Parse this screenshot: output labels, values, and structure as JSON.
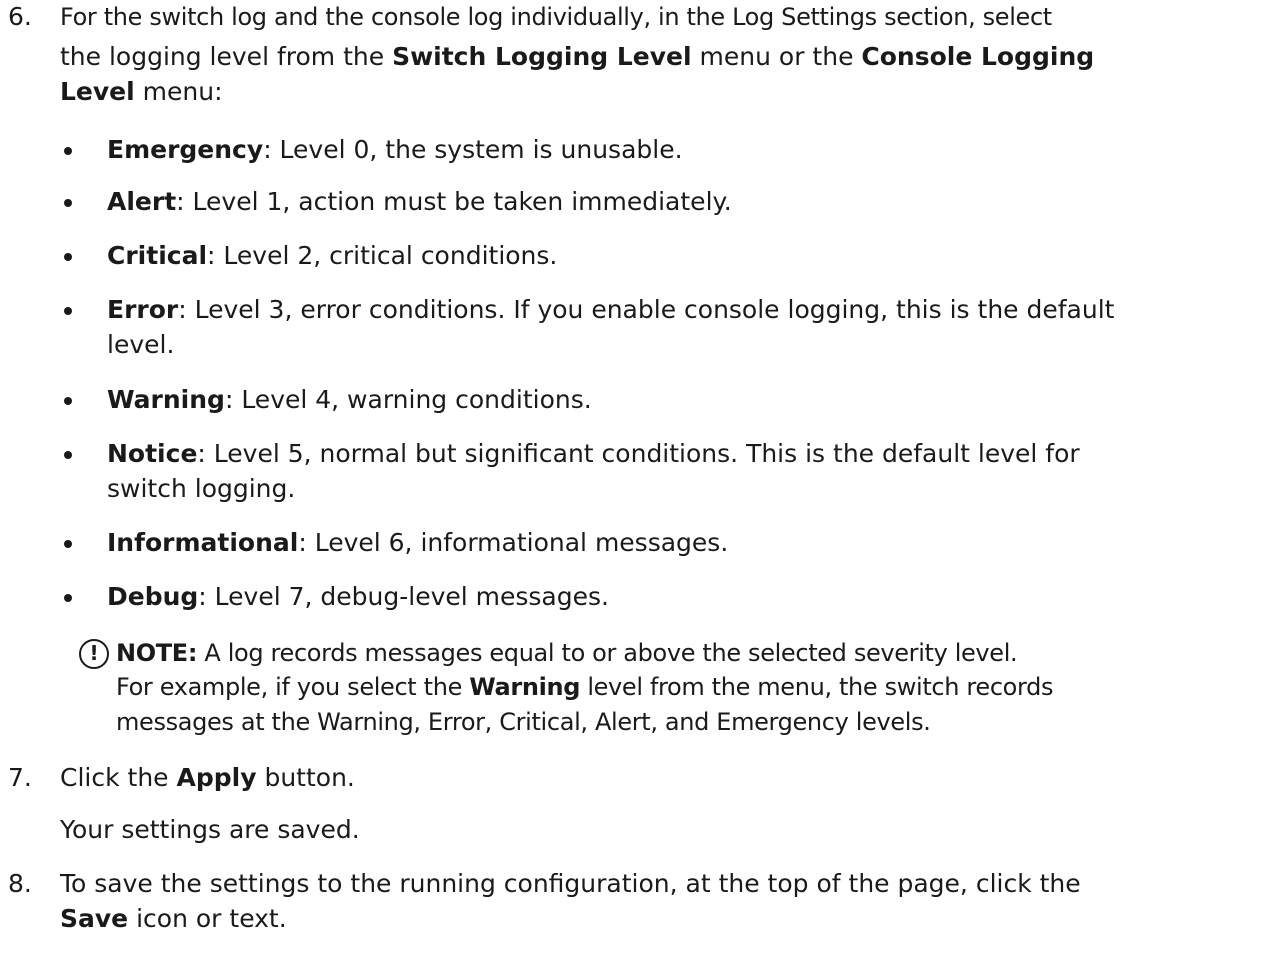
{
  "steps": [
    {
      "number": "6.",
      "lines": [
        [
          "For the switch log and the console log individually, in the Log Settings section, select"
        ],
        [
          "the logging level from the ",
          {
            "b": "Switch Logging Level"
          },
          " menu or the ",
          {
            "b": "Console Logging"
          }
        ],
        [
          {
            "b": "Level"
          },
          " menu:"
        ]
      ]
    },
    {
      "number": "7.",
      "lines": [
        [
          "Click the ",
          {
            "b": "Apply"
          },
          " button."
        ]
      ],
      "result": "Your settings are saved."
    },
    {
      "number": "8.",
      "lines": [
        [
          "To save the settings to the running configuration, at the top of the page, click the"
        ],
        [
          {
            "b": "Save"
          },
          " icon or text."
        ]
      ]
    }
  ],
  "levels": [
    {
      "name": "Emergency",
      "lines": [
        ": Level 0, the system is unusable."
      ]
    },
    {
      "name": "Alert",
      "lines": [
        ": Level 1, action must be taken immediately."
      ]
    },
    {
      "name": "Critical",
      "lines": [
        ": Level 2, critical conditions."
      ]
    },
    {
      "name": "Error",
      "lines": [
        ": Level 3, error conditions. If you enable console logging, this is the default",
        "level."
      ]
    },
    {
      "name": "Warning",
      "lines": [
        ": Level 4, warning conditions."
      ]
    },
    {
      "name": "Notice",
      "lines": [
        ": Level 5, normal but significant conditions. This is the default level for",
        "switch logging."
      ]
    },
    {
      "name": "Informational",
      "lines": [
        ": Level 6, informational messages."
      ]
    },
    {
      "name": "Debug",
      "lines": [
        ": Level 7, debug-level messages."
      ]
    }
  ],
  "note": {
    "icon": "exclamation-circle-icon",
    "glyph": "!",
    "label": "NOTE:",
    "lines": [
      [
        " A log records messages equal to or above the selected severity level."
      ],
      [
        "For example, if you select the ",
        {
          "b": "Warning"
        },
        " level from the menu, the switch records"
      ],
      [
        "messages at the Warning, Error, Critical, Alert, and Emergency levels."
      ]
    ]
  }
}
